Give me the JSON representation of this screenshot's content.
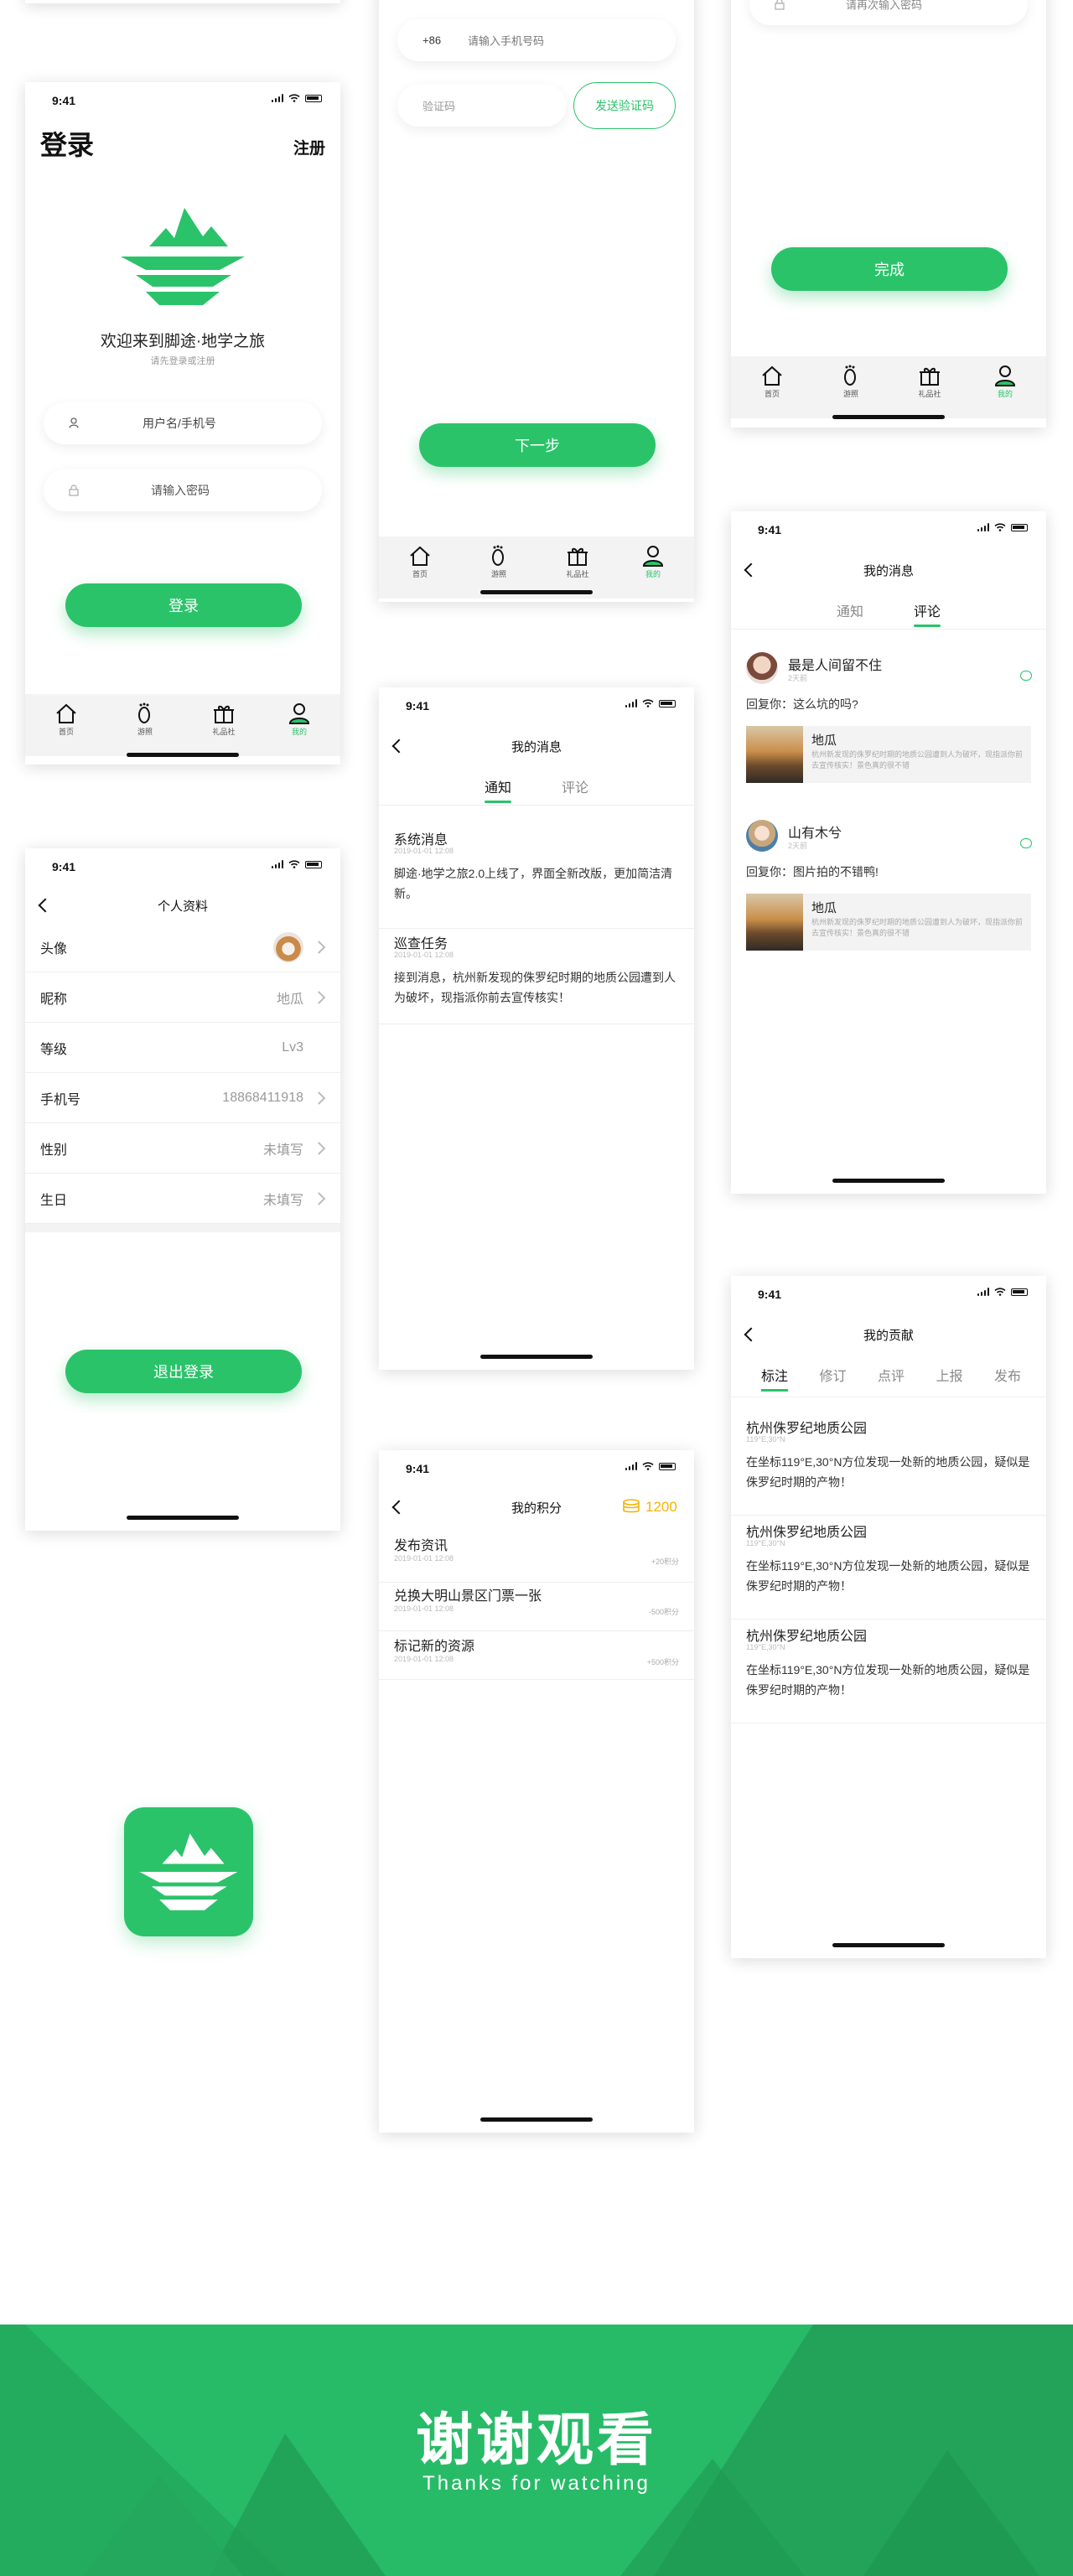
{
  "status_time": "9:41",
  "login": {
    "title": "登录",
    "register": "注册",
    "welcome": "欢迎来到脚途·地学之旅",
    "subtitle": "请先登录或注册",
    "username_placeholder": "用户名/手机号",
    "password_placeholder": "请输入密码",
    "login_button": "登录"
  },
  "tabbar": {
    "items": [
      "首页",
      "游照",
      "礼品社",
      "我的"
    ],
    "active": "我的"
  },
  "register": {
    "country_code": "+86",
    "phone_placeholder": "请输入手机号码",
    "code_placeholder": "验证码",
    "send_code": "发送验证码",
    "next_button": "下一步"
  },
  "reset": {
    "confirm_placeholder": "请再次输入密码",
    "done_button": "完成"
  },
  "profile": {
    "title": "个人资料",
    "rows": [
      {
        "label": "头像",
        "value": ""
      },
      {
        "label": "昵称",
        "value": "地瓜"
      },
      {
        "label": "等级",
        "value": "Lv3"
      },
      {
        "label": "手机号",
        "value": "18868411918"
      },
      {
        "label": "性别",
        "value": "未填写"
      },
      {
        "label": "生日",
        "value": "未填写"
      }
    ],
    "logout_button": "退出登录"
  },
  "messages_notice": {
    "title": "我的消息",
    "tabs": [
      "通知",
      "评论"
    ],
    "items": [
      {
        "title": "系统消息",
        "time": "2019-01-01 12:08",
        "body": "脚途·地学之旅2.0上线了，界面全新改版，更加简洁清新。"
      },
      {
        "title": "巡查任务",
        "time": "2019-01-01 12:08",
        "body": "接到消息，杭州新发现的侏罗纪时期的地质公园遭到人为破坏，现指派你前去宣传核实！"
      }
    ]
  },
  "messages_comment": {
    "title": "我的消息",
    "tabs": [
      "通知",
      "评论"
    ],
    "items": [
      {
        "user": "最是人间留不住",
        "time": "2天前",
        "reply": "回复你：这么坑的吗?",
        "post_title": "地瓜",
        "post_text": "杭州新发现的侏罗纪时期的地质公园遭到人为破坏，现指派你前去宣传核实！景色真的很不错"
      },
      {
        "user": "山有木兮",
        "time": "2天前",
        "reply": "回复你：图片拍的不错鸭!",
        "post_title": "地瓜",
        "post_text": "杭州新发现的侏罗纪时期的地质公园遭到人为破坏，现指派你前去宣传核实！景色真的很不错"
      }
    ]
  },
  "points": {
    "title": "我的积分",
    "total": "1200",
    "items": [
      {
        "title": "发布资讯",
        "time": "2019-01-01 12:08",
        "delta": "+20积分"
      },
      {
        "title": "兑换大明山景区门票一张",
        "time": "2019-01-01 12:08",
        "delta": "-500积分"
      },
      {
        "title": "标记新的资源",
        "time": "2019-01-01 12:08",
        "delta": "+500积分"
      }
    ]
  },
  "contrib": {
    "title": "我的贡献",
    "tabs": [
      "标注",
      "修订",
      "点评",
      "上报",
      "发布"
    ],
    "items": [
      {
        "title": "杭州侏罗纪地质公园",
        "coord": "119°E,30°N",
        "body": "在坐标119°E,30°N方位发现一处新的地质公园，疑似是侏罗纪时期的产物！"
      },
      {
        "title": "杭州侏罗纪地质公园",
        "coord": "119°E,30°N",
        "body": "在坐标119°E,30°N方位发现一处新的地质公园，疑似是侏罗纪时期的产物！"
      },
      {
        "title": "杭州侏罗纪地质公园",
        "coord": "119°E,30°N",
        "body": "在坐标119°E,30°N方位发现一处新的地质公园，疑似是侏罗纪时期的产物！"
      }
    ]
  },
  "thanks": {
    "title": "谢谢观看",
    "subtitle": "Thanks for watching"
  },
  "colors": {
    "brand_green": "#2ac36a",
    "gold": "#f5b400"
  }
}
